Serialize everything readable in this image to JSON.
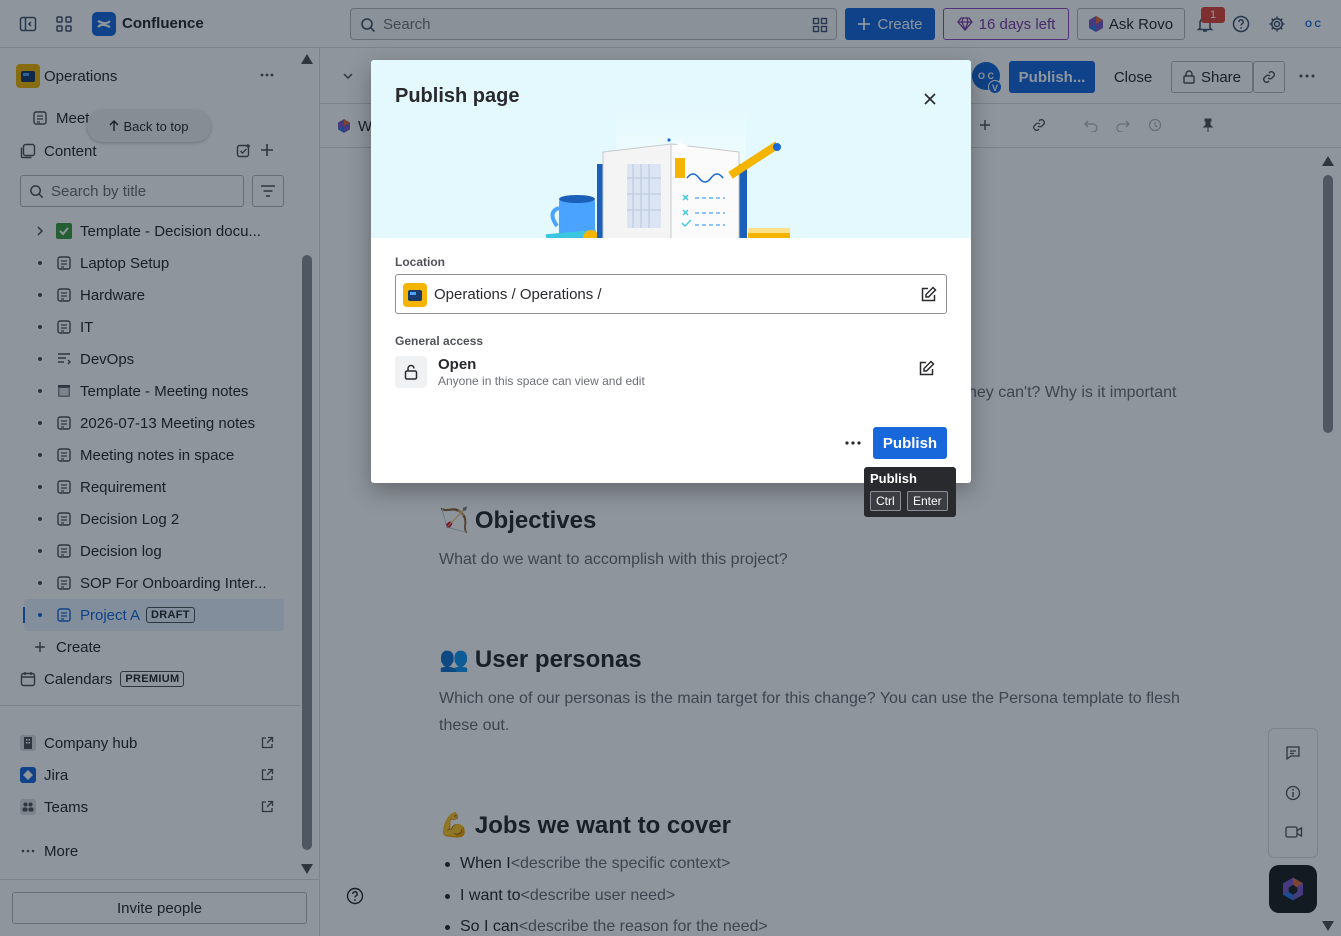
{
  "topbar": {
    "app_name": "Confluence",
    "search_placeholder": "Search",
    "create_label": "Create",
    "trial_label": "16 days left",
    "rovo_label": "Ask Rovo",
    "notification_count": "1",
    "avatar_initials": "O C"
  },
  "sidebar": {
    "space_name": "Operations",
    "meeting_partial": "Meet",
    "back_to_top": "Back to top",
    "content_label": "Content",
    "search_placeholder": "Search by title",
    "tree": [
      {
        "label": "Template - Decision docu...",
        "icon": "checkbox-icon",
        "expandable": true
      },
      {
        "label": "Laptop Setup",
        "icon": "page-icon"
      },
      {
        "label": "Hardware",
        "icon": "page-icon"
      },
      {
        "label": "IT",
        "icon": "page-icon"
      },
      {
        "label": "DevOps",
        "icon": "list-page-icon"
      },
      {
        "label": "Template - Meeting notes",
        "icon": "calendar-page-icon"
      },
      {
        "label": "2026-07-13 Meeting notes",
        "icon": "page-icon"
      },
      {
        "label": "Meeting notes in space",
        "icon": "page-icon"
      },
      {
        "label": "Requirement",
        "icon": "page-icon"
      },
      {
        "label": "Decision Log 2",
        "icon": "page-icon"
      },
      {
        "label": "Decision log",
        "icon": "page-icon"
      },
      {
        "label": "SOP For Onboarding Inter...",
        "icon": "page-icon"
      },
      {
        "label": "Project A",
        "icon": "page-icon",
        "badge": "DRAFT",
        "selected": true
      }
    ],
    "create_label": "Create",
    "calendars_label": "Calendars",
    "calendars_badge": "PREMIUM",
    "links": [
      {
        "label": "Company hub",
        "icon": "building-icon"
      },
      {
        "label": "Jira",
        "icon": "jira-icon"
      },
      {
        "label": "Teams",
        "icon": "teams-icon"
      }
    ],
    "more_label": "More",
    "invite_label": "Invite people"
  },
  "page_toolbar": {
    "publish_label": "Publish...",
    "close_label": "Close",
    "share_label": "Share",
    "editor_avatar": "O C",
    "editor_avatar_sub": "V",
    "toolbar_partial": "W"
  },
  "content": {
    "partial_question": "hey can't? Why is it important",
    "objectives_heading": "Objectives",
    "objectives_emoji": "🏹",
    "objectives_text": "What do we want to accomplish with this project?",
    "personas_heading": "User personas",
    "personas_emoji": "👥",
    "personas_text": "Which one of our personas is the main target for this change? You can use the Persona template to flesh these out.",
    "jobs_heading": "Jobs we want to cover",
    "jobs_emoji": "💪",
    "jobs": [
      {
        "lead": "When I",
        "placeholder": "<describe the specific context>"
      },
      {
        "lead": "I want to",
        "placeholder": "<describe user need>"
      },
      {
        "lead": "So I can",
        "placeholder": "<describe the reason for the need>"
      }
    ]
  },
  "modal": {
    "title": "Publish page",
    "location_label": "Location",
    "location_value": "Operations / Operations /",
    "access_label": "General access",
    "access_title": "Open",
    "access_desc": "Anyone in this space can view and edit",
    "publish_label": "Publish"
  },
  "tooltip": {
    "title": "Publish",
    "key1": "Ctrl",
    "key2": "Enter"
  },
  "colors": {
    "brand": "#1868db",
    "trial": "#803fa5",
    "overlay": "rgba(5,21,36,0.45)"
  }
}
